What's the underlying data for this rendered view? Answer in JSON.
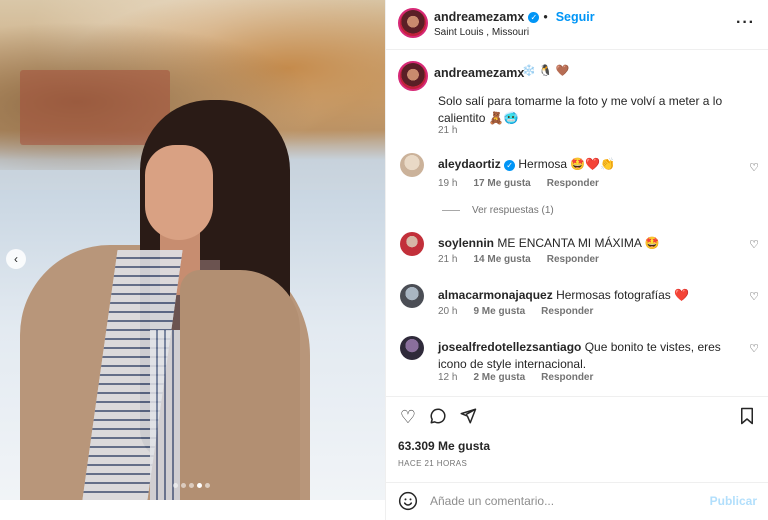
{
  "post": {
    "username": "andreamezamx",
    "follow_label": "Seguir",
    "separator": "•",
    "location": "Saint Louis , Missouri",
    "more_icon": "more-dots-icon"
  },
  "photo": {
    "carousel_prev_icon": "chevron-left-icon",
    "carousel_dots": 5,
    "carousel_active_dot": 4
  },
  "caption": {
    "username": "andreamezamx",
    "emojis": "❄️ 🐧 🤎",
    "text": "Solo salí para tomarme la foto y me volví a meter a lo calientito 🧸🥶",
    "time": "21 h"
  },
  "comments": [
    {
      "username": "aleydaortiz",
      "text": "Hermosa 🤩❤️👏",
      "time": "19 h",
      "likes": "17 Me gusta",
      "reply": "Responder",
      "verified": true
    },
    {
      "username": "soylennin",
      "text": "ME ENCANTA MI MÁXIMA 🤩",
      "time": "21 h",
      "likes": "14 Me gusta",
      "reply": "Responder",
      "verified": false
    },
    {
      "username": "almacarmonajaquez",
      "text": "Hermosas fotografías ❤️",
      "time": "20 h",
      "likes": "9 Me gusta",
      "reply": "Responder",
      "verified": false
    },
    {
      "username": "josealfredotellezsantiago",
      "text": "Que bonito te vistes, eres icono de style internacional.",
      "time": "12 h",
      "likes": "2 Me gusta",
      "reply": "Responder",
      "verified": false
    }
  ],
  "view_replies": "Ver respuestas (1)",
  "actions": {
    "likes": "63.309 Me gusta",
    "posted": "HACE 21 HORAS"
  },
  "add_comment": {
    "placeholder": "Añade un comentario...",
    "publish": "Publicar"
  },
  "colors": {
    "accent": "#0095f6",
    "muted": "#737373",
    "publish_disabled": "#b2dffc"
  }
}
